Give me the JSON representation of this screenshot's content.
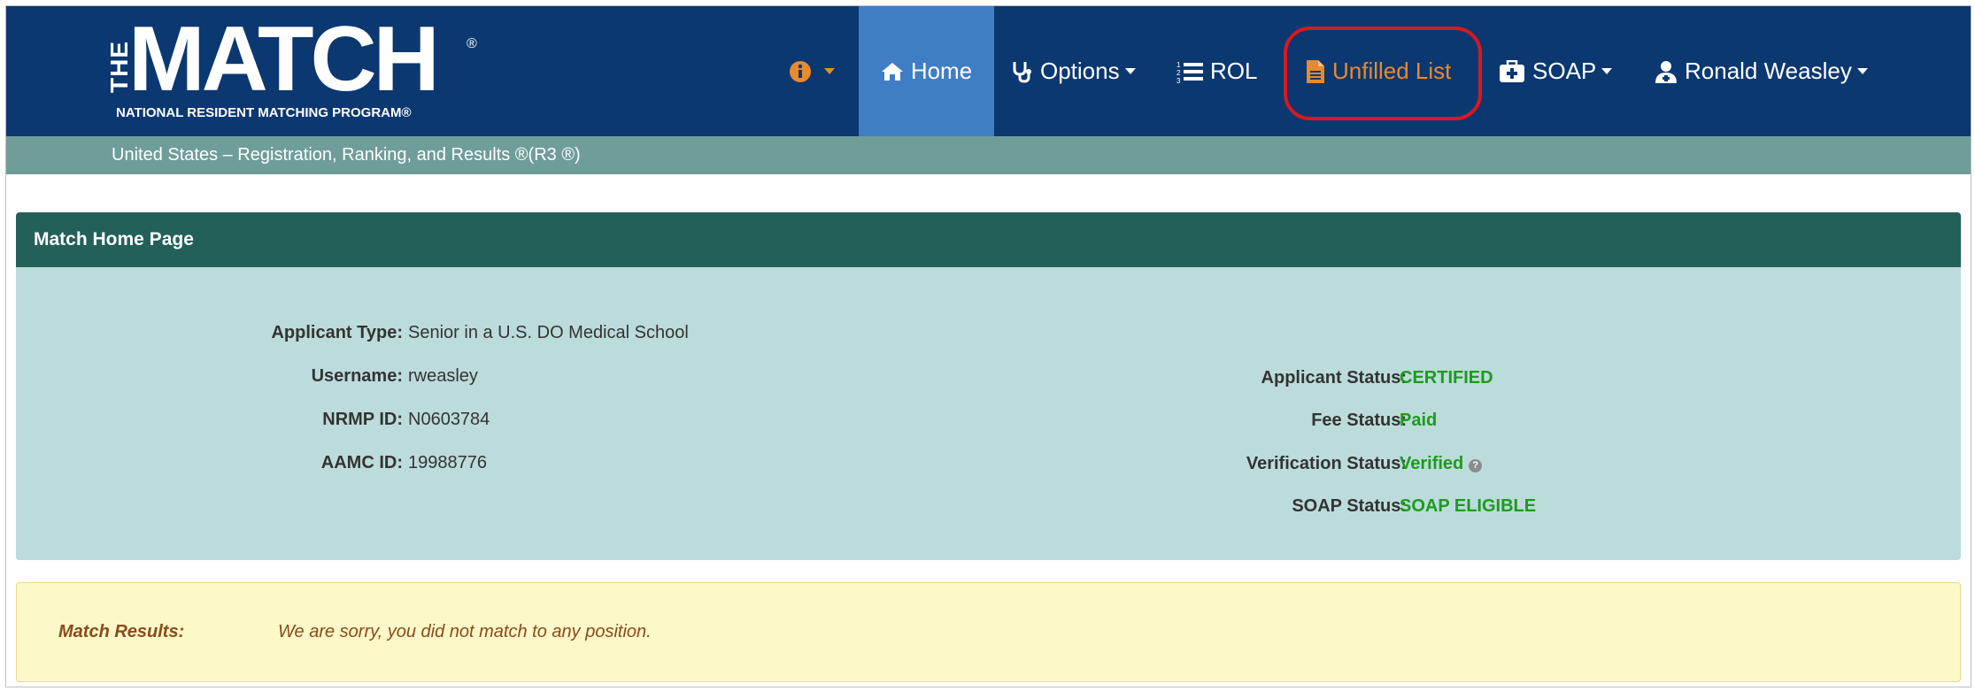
{
  "logo": {
    "the": "THE",
    "match": "MATCH",
    "reg": "®",
    "subtitle": "NATIONAL RESIDENT MATCHING PROGRAM®"
  },
  "nav": {
    "info_icon": "info-circle-icon",
    "home": "Home",
    "options": "Options",
    "rol": "ROL",
    "unfilled": "Unfilled List",
    "soap": "SOAP",
    "user": "Ronald Weasley"
  },
  "subbar": "United States  – Registration, Ranking, and Results ®(R3 ®)",
  "panel": {
    "title": "Match Home Page",
    "left": {
      "applicant_type_label": "Applicant Type:",
      "applicant_type": "Senior in a U.S. DO Medical School",
      "username_label": "Username:",
      "username": "rweasley",
      "nrmp_label": "NRMP ID:",
      "nrmp": "N0603784",
      "aamc_label": "AAMC ID:",
      "aamc": "19988776"
    },
    "right": {
      "applicant_status_label": "Applicant Status:",
      "applicant_status": "CERTIFIED",
      "fee_status_label": "Fee Status:",
      "fee_status": "Paid",
      "verification_label": "Verification Status:",
      "verification": "Verified",
      "soap_label": "SOAP Status:",
      "soap": "SOAP ELIGIBLE"
    }
  },
  "results": {
    "label": "Match Results:",
    "value": "We are sorry, you did not match to any position."
  },
  "colors": {
    "navbar": "#0b3870",
    "home_active": "#3f7ec4",
    "subbar": "#6f9d9a",
    "panel_head": "#23605a",
    "panel_body": "#bcdcdb",
    "status_green": "#1e9a1e",
    "highlight": "#d71920",
    "unfilled_orange": "#e88a2e"
  }
}
